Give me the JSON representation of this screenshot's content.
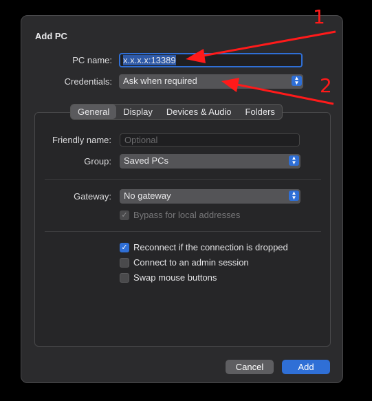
{
  "dialog": {
    "title": "Add PC"
  },
  "form": {
    "pc_name_label": "PC name:",
    "pc_name_value": "x.x.x.x:13389",
    "credentials_label": "Credentials:",
    "credentials_value": "Ask when required"
  },
  "tabs": [
    {
      "label": "General",
      "active": true
    },
    {
      "label": "Display",
      "active": false
    },
    {
      "label": "Devices & Audio",
      "active": false
    },
    {
      "label": "Folders",
      "active": false
    }
  ],
  "general": {
    "friendly_name_label": "Friendly name:",
    "friendly_name_placeholder": "Optional",
    "group_label": "Group:",
    "group_value": "Saved PCs",
    "gateway_label": "Gateway:",
    "gateway_value": "No gateway",
    "bypass_label": "Bypass for local addresses",
    "bypass_checked": true,
    "options": [
      {
        "label": "Reconnect if the connection is dropped",
        "checked": true
      },
      {
        "label": "Connect to an admin session",
        "checked": false
      },
      {
        "label": "Swap mouse buttons",
        "checked": false
      }
    ]
  },
  "buttons": {
    "cancel": "Cancel",
    "add": "Add"
  },
  "annotations": {
    "one": "1",
    "two": "2"
  },
  "colors": {
    "accent": "#2f6fd6",
    "annotation": "#ff1a1a",
    "dialog_bg": "#2b2b2d"
  },
  "icons": {
    "check": "checkmark-icon",
    "popup": "popup-chevrons-icon"
  }
}
